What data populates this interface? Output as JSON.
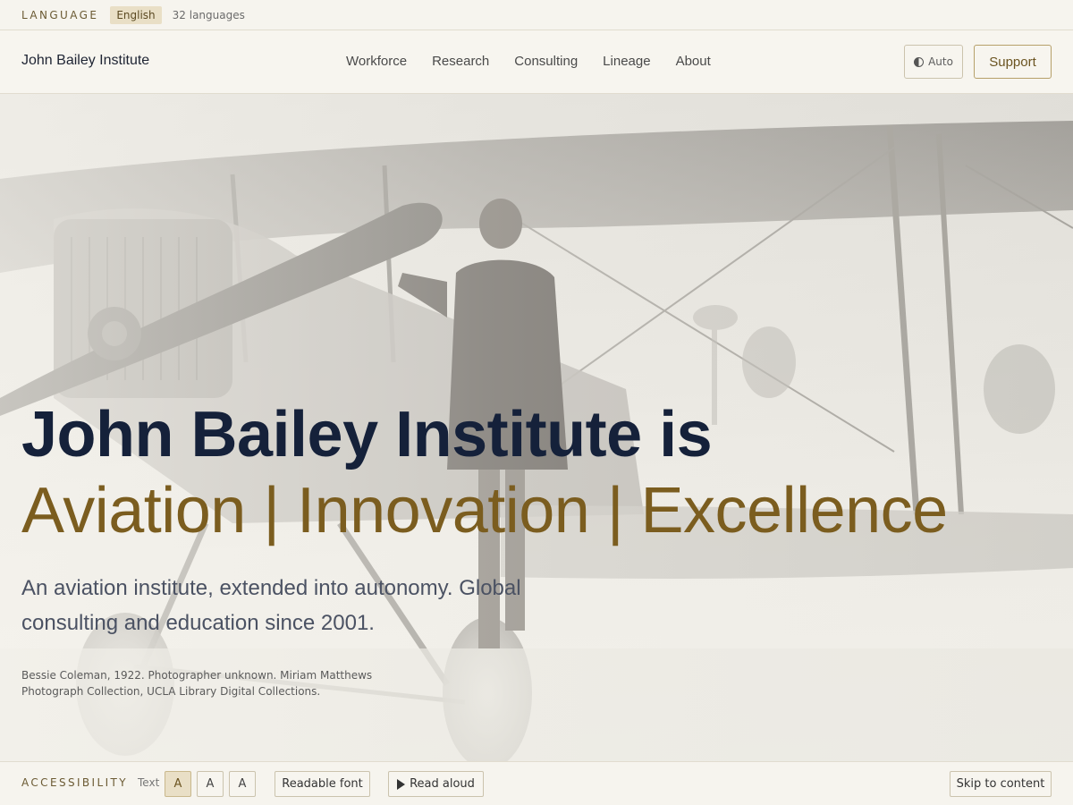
{
  "language_bar": {
    "label": "LANGUAGE",
    "current": "English",
    "count": "32 languages"
  },
  "header": {
    "brand": "John Bailey Institute",
    "nav": [
      "Workforce",
      "Research",
      "Consulting",
      "Lineage",
      "About"
    ],
    "theme_label": "Auto",
    "theme_icon": "half-circle-icon",
    "support_label": "Support"
  },
  "hero": {
    "headline_1": "John Bailey Institute is",
    "headline_2": "Aviation | Innovation | Excellence",
    "subtitle": "An aviation institute, extended into autonomy. Global consulting and education since 2001.",
    "caption": "Bessie Coleman, 1922. Photographer unknown. Miriam Matthews Photograph Collection, UCLA Library Digital Collections."
  },
  "accessibility_bar": {
    "label": "ACCESSIBILITY",
    "text_label": "Text",
    "sizes": [
      "A",
      "A",
      "A"
    ],
    "active_size": 0,
    "readable_font": "Readable font",
    "read_aloud": "Read aloud",
    "read_aloud_icon": "play-icon",
    "skip": "Skip to content"
  },
  "colors": {
    "navy": "#15213a",
    "gold": "#7b5d1f",
    "accent_bg": "#e9dfc6",
    "page_bg": "#f6f4ee"
  }
}
